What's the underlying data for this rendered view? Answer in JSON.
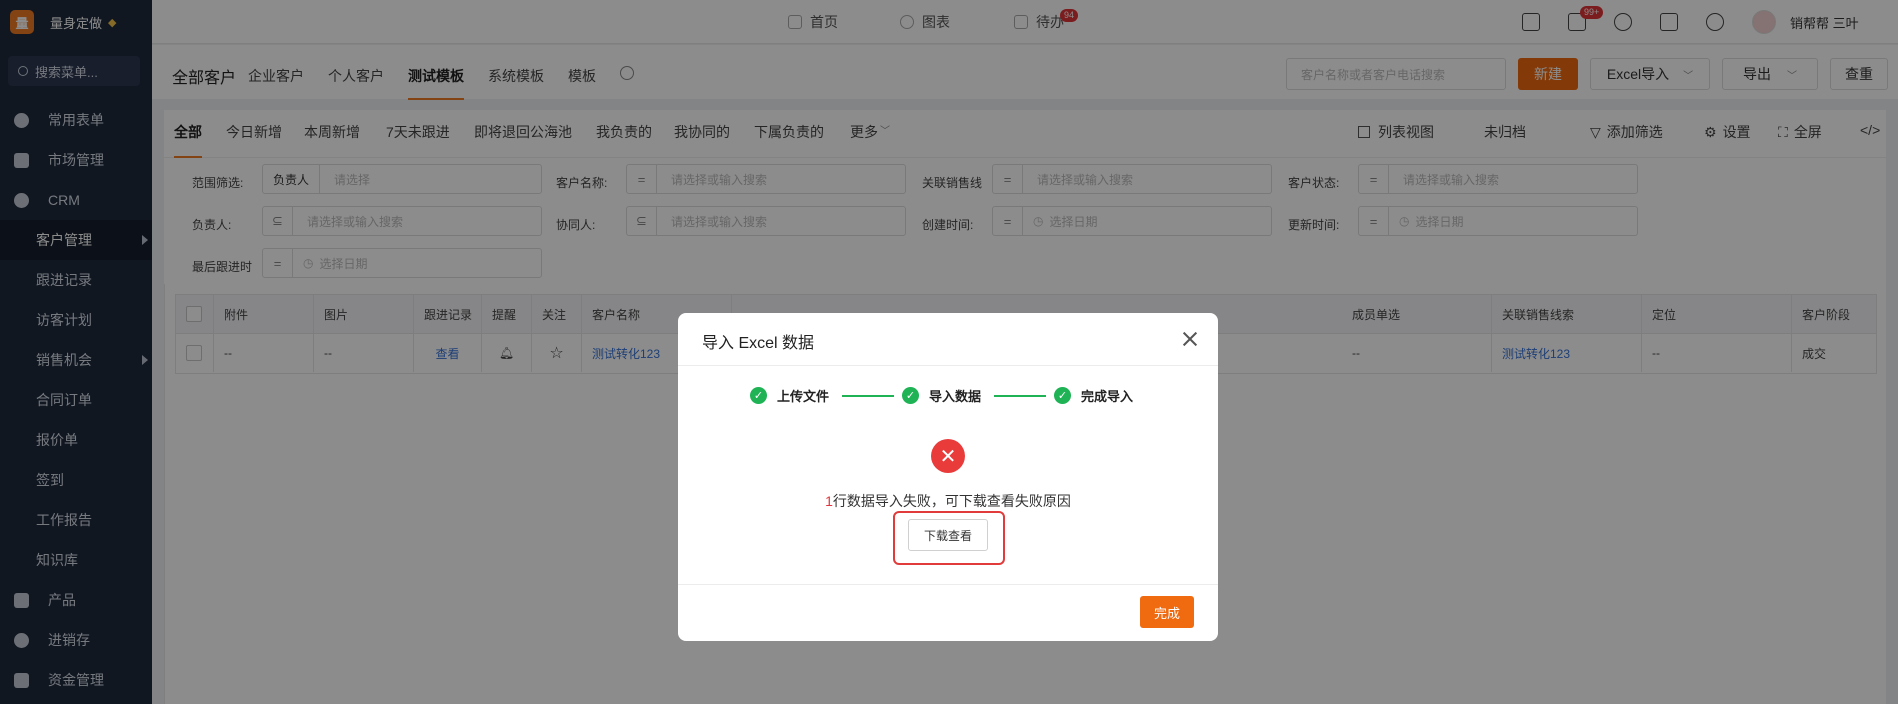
{
  "app": {
    "name": "量身定做",
    "logo_char": "量"
  },
  "sidebar": {
    "search_placeholder": "搜索菜单...",
    "items": [
      {
        "label": "常用表单"
      },
      {
        "label": "市场管理"
      },
      {
        "label": "CRM"
      }
    ],
    "crm_sub": [
      {
        "label": "客户管理"
      },
      {
        "label": "跟进记录"
      },
      {
        "label": "访客计划"
      },
      {
        "label": "销售机会"
      },
      {
        "label": "合同订单"
      },
      {
        "label": "报价单"
      },
      {
        "label": "签到"
      },
      {
        "label": "工作报告"
      },
      {
        "label": "知识库"
      }
    ],
    "bottom_items": [
      {
        "label": "产品"
      },
      {
        "label": "进销存"
      },
      {
        "label": "资金管理"
      }
    ]
  },
  "topbar": {
    "nav": [
      {
        "label": "首页"
      },
      {
        "label": "图表"
      },
      {
        "label": "待办"
      }
    ],
    "todo_badge": "94",
    "chat_badge": "99+",
    "user_name": "销帮帮 三叶"
  },
  "page": {
    "title": "全部客户",
    "tabs": [
      {
        "label": "企业客户"
      },
      {
        "label": "个人客户"
      },
      {
        "label": "测试模板"
      },
      {
        "label": "系统模板"
      },
      {
        "label": "模板"
      }
    ],
    "search_placeholder": "客户名称或者客户电话搜索",
    "new_label": "新建",
    "excel_import_label": "Excel导入",
    "export_label": "导出",
    "dedupe_label": "查重"
  },
  "filter_tabs": {
    "tabs": [
      {
        "label": "全部"
      },
      {
        "label": "今日新增"
      },
      {
        "label": "本周新增"
      },
      {
        "label": "7天未跟进"
      },
      {
        "label": "即将退回公海池"
      },
      {
        "label": "我负责的"
      },
      {
        "label": "我协同的"
      },
      {
        "label": "下属负责的"
      },
      {
        "label": "更多"
      }
    ],
    "list_view": "列表视图",
    "unarchived": "未归档",
    "add_filter": "添加筛选",
    "settings": "设置",
    "fullscreen": "全屏"
  },
  "filters": {
    "scope_label": "范围筛选:",
    "scope_value": "负责人",
    "scope_placeholder": "请选择",
    "customer_name_label": "客户名称:",
    "select_or_search": "请选择或输入搜索",
    "sales_line_label": "关联销售线",
    "status_label": "客户状态:",
    "owner_label": "负责人:",
    "collaborator_label": "协同人:",
    "created_label": "创建时间:",
    "updated_label": "更新时间:",
    "last_follow_label": "最后跟进时",
    "date_placeholder": "选择日期"
  },
  "table": {
    "headers": [
      "附件",
      "图片",
      "跟进记录",
      "提醒",
      "关注",
      "客户名称",
      "成员单选",
      "关联销售线索",
      "定位",
      "客户阶段"
    ],
    "row": {
      "attachment": "--",
      "image": "--",
      "follow": "查看",
      "name": "测试转化123",
      "member": "--",
      "lead": "测试转化123",
      "location": "--",
      "stage": "成交"
    }
  },
  "modal": {
    "title": "导入 Excel 数据",
    "steps": [
      {
        "label": "上传文件"
      },
      {
        "label": "导入数据"
      },
      {
        "label": "完成导入"
      }
    ],
    "fail_count": "1",
    "fail_text": "行数据导入失败，可下载查看失败原因",
    "download_label": "下载查看",
    "done_label": "完成"
  },
  "colors": {
    "accent": "#f06a0f",
    "sidebar_bg": "#1f2a3d",
    "success": "#1fb355",
    "error": "#ea3b3b",
    "link": "#3572d8"
  }
}
